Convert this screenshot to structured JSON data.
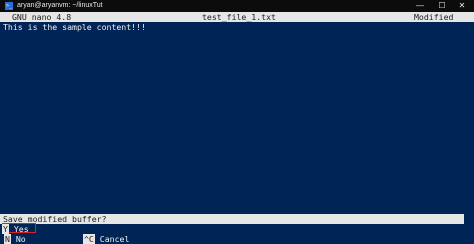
{
  "window": {
    "title": "aryan@aryanvm: ~/linuxTut",
    "icon": "terminal-icon",
    "controls": {
      "minimize": "—",
      "maximize": "☐",
      "close": "✕"
    }
  },
  "nano": {
    "version": "GNU nano 4.8",
    "filename": "test_file_1.txt",
    "status": "Modified",
    "content": "This is the sample content!!!"
  },
  "prompt": {
    "question": "Save modified buffer?",
    "options": {
      "yes": {
        "key": "Y",
        "label": "Yes"
      },
      "no": {
        "key": "N",
        "label": "No"
      },
      "cancel": {
        "key": "^C",
        "label": "Cancel"
      }
    }
  },
  "colors": {
    "terminal_bg": "#012456",
    "bar_bg": "#e6e6e6",
    "highlight_border": "#e02020"
  }
}
